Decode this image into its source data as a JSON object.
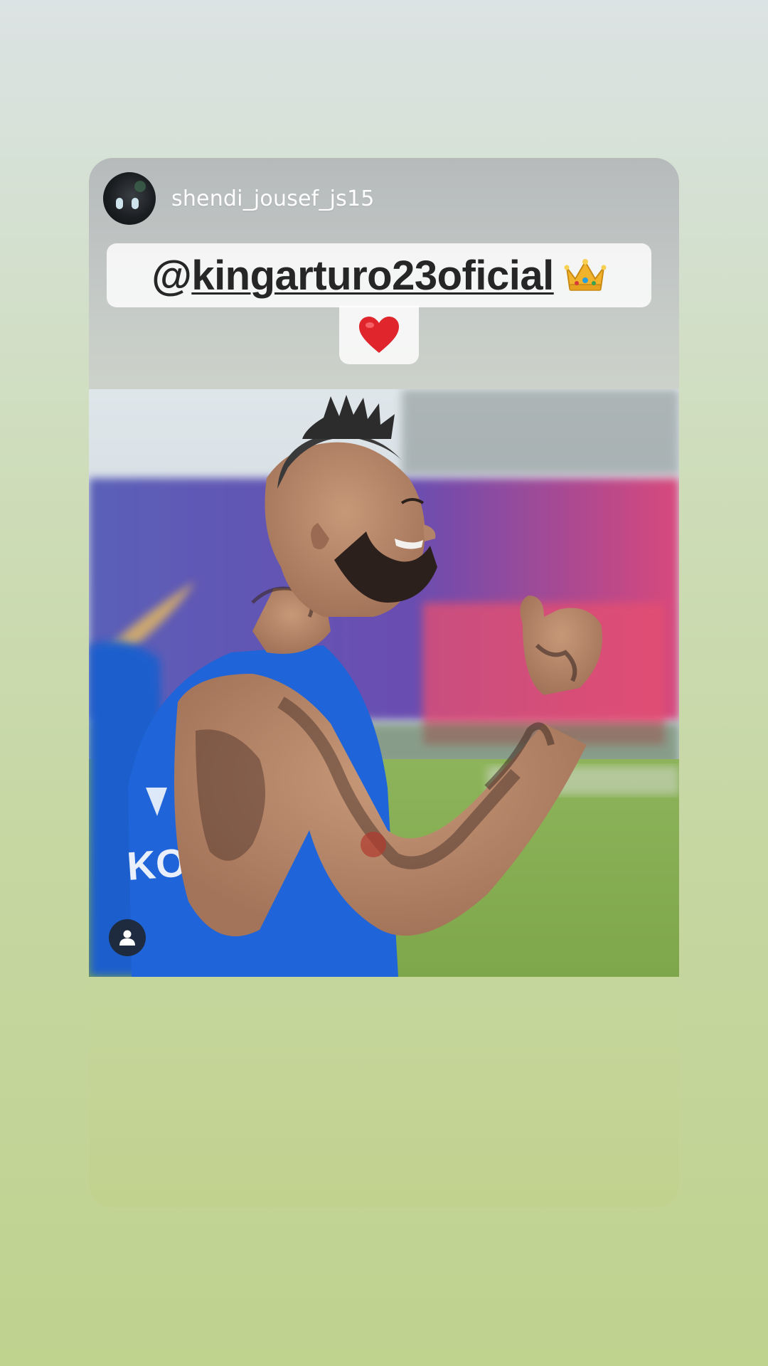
{
  "post": {
    "username": "shendi_jousef_js15",
    "caption": {
      "at": "@",
      "handle": "kingarturo23oficial"
    },
    "emoji": {
      "crown": "crown-icon",
      "heart": "heart-icon"
    }
  },
  "icons": {
    "tag": "user-tag-icon"
  },
  "colors": {
    "caption_text": "#262626",
    "heart": "#e0262c",
    "jersey": "#1f64d8",
    "grass": "#7ea64a",
    "background_top": "#dce3e4",
    "background_bottom": "#bfd28e"
  }
}
